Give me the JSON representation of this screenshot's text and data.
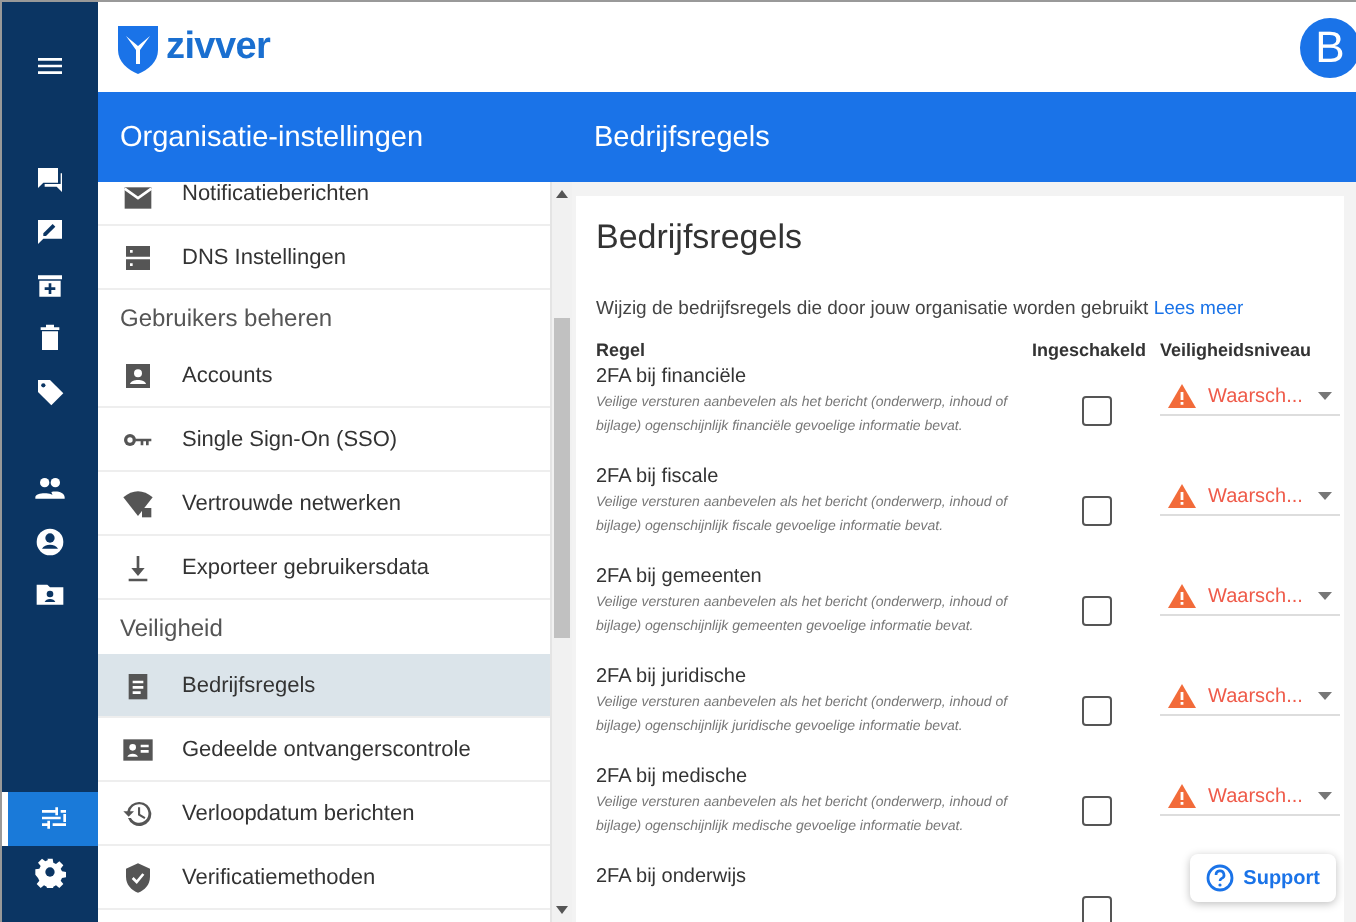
{
  "app": {
    "logo_text": "zivver",
    "avatar": "B"
  },
  "rail": [
    {
      "selected": false
    },
    {
      "selected": false
    },
    {
      "selected": false
    },
    {
      "selected": false
    },
    {
      "selected": false
    },
    {
      "selected": false
    },
    {
      "selected": false
    },
    {
      "selected": false
    },
    {
      "selected": false
    },
    {
      "selected": true
    },
    {
      "selected": false
    }
  ],
  "sidebar": {
    "title": "Organisatie-instellingen",
    "items": [
      {
        "kind": "item",
        "label": "Notificatieberichten",
        "selected": false
      },
      {
        "kind": "item",
        "label": "DNS Instellingen",
        "selected": false
      },
      {
        "kind": "header",
        "label": "Gebruikers beheren"
      },
      {
        "kind": "item",
        "label": "Accounts",
        "selected": false
      },
      {
        "kind": "item",
        "label": "Single Sign-On (SSO)",
        "selected": false
      },
      {
        "kind": "item",
        "label": "Vertrouwde netwerken",
        "selected": false
      },
      {
        "kind": "item",
        "label": "Exporteer gebruikersdata",
        "selected": false
      },
      {
        "kind": "header",
        "label": "Veiligheid"
      },
      {
        "kind": "item",
        "label": "Bedrijfsregels",
        "selected": true
      },
      {
        "kind": "item",
        "label": "Gedeelde ontvangerscontrole",
        "selected": false
      },
      {
        "kind": "item",
        "label": "Verloopdatum berichten",
        "selected": false
      },
      {
        "kind": "item",
        "label": "Verificatiemethoden",
        "selected": false
      }
    ]
  },
  "content": {
    "bar_title": "Bedrijfsregels",
    "heading": "Bedrijfsregels",
    "intro": "Wijzig de bedrijfsregels die door jouw organisatie worden gebruikt",
    "intro_link": "Lees meer",
    "columns": [
      "Regel",
      "Ingeschakeld",
      "Veiligheidsniveau"
    ],
    "rules": [
      {
        "title": "2FA bij financiële",
        "description": "Veilige versturen aanbevelen als het bericht (onderwerp, inhoud of bijlage) ogenschijnlijk financiële gevoelige informatie bevat.",
        "enabled": false,
        "level": "Waarsch..."
      },
      {
        "title": "2FA bij fiscale",
        "description": "Veilige versturen aanbevelen als het bericht (onderwerp, inhoud of bijlage) ogenschijnlijk fiscale gevoelige informatie bevat.",
        "enabled": false,
        "level": "Waarsch..."
      },
      {
        "title": "2FA bij gemeenten",
        "description": "Veilige versturen aanbevelen als het bericht (onderwerp, inhoud of bijlage) ogenschijnlijk gemeenten gevoelige informatie bevat.",
        "enabled": false,
        "level": "Waarsch..."
      },
      {
        "title": "2FA bij juridische",
        "description": "Veilige versturen aanbevelen als het bericht (onderwerp, inhoud of bijlage) ogenschijnlijk juridische gevoelige informatie bevat.",
        "enabled": false,
        "level": "Waarsch..."
      },
      {
        "title": "2FA bij medische",
        "description": "Veilige versturen aanbevelen als het bericht (onderwerp, inhoud of bijlage) ogenschijnlijk medische gevoelige informatie bevat.",
        "enabled": false,
        "level": "Waarsch..."
      },
      {
        "title": "2FA bij onderwijs",
        "enabled": false
      }
    ]
  },
  "support": {
    "label": "Support"
  }
}
